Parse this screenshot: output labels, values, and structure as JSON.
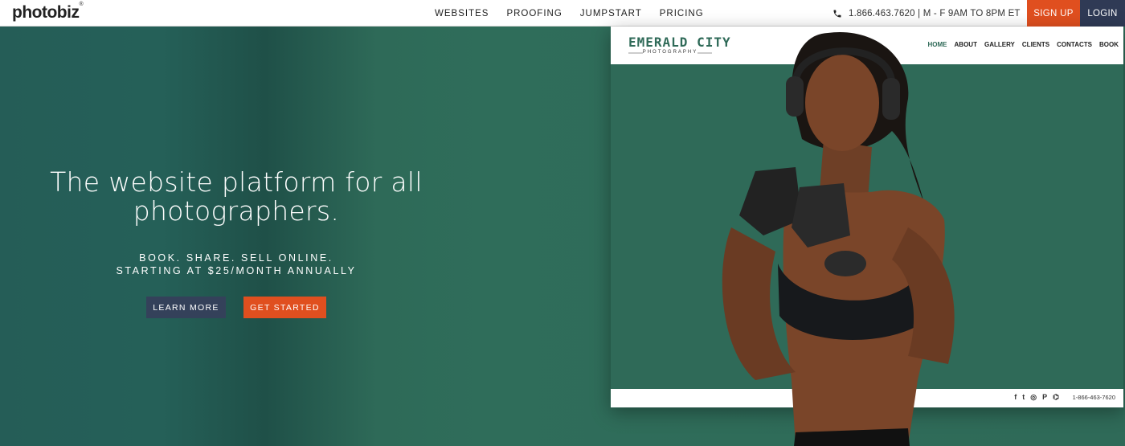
{
  "brand": {
    "logo": "photobiz",
    "registered": "®"
  },
  "nav": {
    "links": [
      "WEBSITES",
      "PROOFING",
      "JUMPSTART",
      "PRICING"
    ],
    "phone": "1.866.463.7620 | M - F 9AM TO 8PM ET",
    "signup": "SIGN UP",
    "login": "LOGIN"
  },
  "hero": {
    "title_line1": "The website platform for all",
    "title_line2": "photographers.",
    "sub_line1": "BOOK. SHARE. SELL ONLINE.",
    "sub_line2": "STARTING AT $25/MONTH ANNUALLY",
    "learn_more": "LEARN MORE",
    "get_started": "GET STARTED"
  },
  "mockup": {
    "logo_main": "EMERALD CITY",
    "logo_sub": "PHOTOGRAPHY",
    "nav": [
      "HOME",
      "ABOUT",
      "GALLERY",
      "CLIENTS",
      "CONTACTS",
      "BOOK"
    ],
    "phone": "1-866-463-7620",
    "social": [
      "f",
      "t",
      "◎",
      "P",
      "⌬"
    ]
  },
  "colors": {
    "accent": "#e04f1f",
    "navy": "#2f3a55",
    "green": "#2f6a58"
  }
}
